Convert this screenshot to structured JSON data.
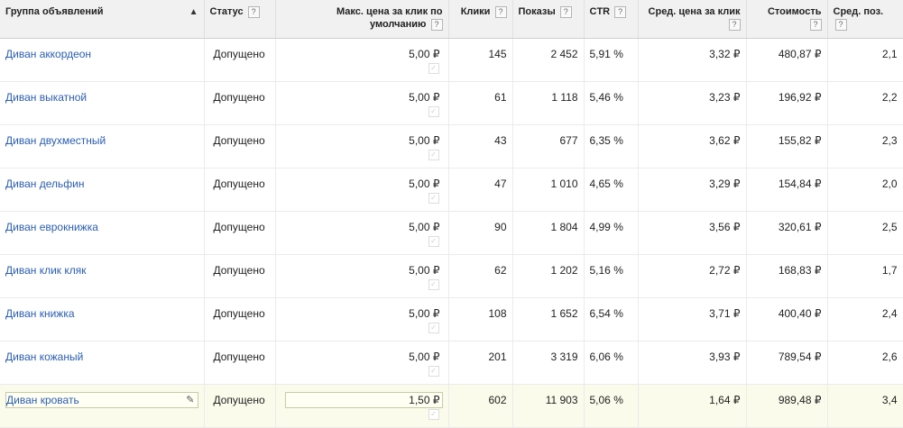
{
  "headers": {
    "group": "Группа объявлений",
    "status": "Статус",
    "max_cpc": "Макс. цена за клик по умолчанию",
    "clicks": "Клики",
    "impressions": "Показы",
    "ctr": "CTR",
    "avg_cpc": "Сред. цена за клик",
    "cost": "Стоимость",
    "avg_pos": "Сред. поз."
  },
  "help_glyph": "?",
  "sort_glyph": "▲",
  "edit_glyph": "✎",
  "check_glyph": "✓",
  "rows": [
    {
      "group": "Диван аккордеон",
      "status": "Допущено",
      "max_cpc": "5,00 ₽",
      "clicks": "145",
      "impressions": "2 452",
      "ctr": "5,91 %",
      "avg_cpc": "3,32 ₽",
      "cost": "480,87 ₽",
      "avg_pos": "2,1"
    },
    {
      "group": "Диван выкатной",
      "status": "Допущено",
      "max_cpc": "5,00 ₽",
      "clicks": "61",
      "impressions": "1 118",
      "ctr": "5,46 %",
      "avg_cpc": "3,23 ₽",
      "cost": "196,92 ₽",
      "avg_pos": "2,2"
    },
    {
      "group": "Диван двухместный",
      "status": "Допущено",
      "max_cpc": "5,00 ₽",
      "clicks": "43",
      "impressions": "677",
      "ctr": "6,35 %",
      "avg_cpc": "3,62 ₽",
      "cost": "155,82 ₽",
      "avg_pos": "2,3"
    },
    {
      "group": "Диван дельфин",
      "status": "Допущено",
      "max_cpc": "5,00 ₽",
      "clicks": "47",
      "impressions": "1 010",
      "ctr": "4,65 %",
      "avg_cpc": "3,29 ₽",
      "cost": "154,84 ₽",
      "avg_pos": "2,0"
    },
    {
      "group": "Диван еврокнижка",
      "status": "Допущено",
      "max_cpc": "5,00 ₽",
      "clicks": "90",
      "impressions": "1 804",
      "ctr": "4,99 %",
      "avg_cpc": "3,56 ₽",
      "cost": "320,61 ₽",
      "avg_pos": "2,5"
    },
    {
      "group": "Диван клик кляк",
      "status": "Допущено",
      "max_cpc": "5,00 ₽",
      "clicks": "62",
      "impressions": "1 202",
      "ctr": "5,16 %",
      "avg_cpc": "2,72 ₽",
      "cost": "168,83 ₽",
      "avg_pos": "1,7"
    },
    {
      "group": "Диван книжка",
      "status": "Допущено",
      "max_cpc": "5,00 ₽",
      "clicks": "108",
      "impressions": "1 652",
      "ctr": "6,54 %",
      "avg_cpc": "3,71 ₽",
      "cost": "400,40 ₽",
      "avg_pos": "2,4"
    },
    {
      "group": "Диван кожаный",
      "status": "Допущено",
      "max_cpc": "5,00 ₽",
      "clicks": "201",
      "impressions": "3 319",
      "ctr": "6,06 %",
      "avg_cpc": "3,93 ₽",
      "cost": "789,54 ₽",
      "avg_pos": "2,6"
    },
    {
      "group": "Диван кровать",
      "status": "Допущено",
      "max_cpc": "1,50 ₽",
      "clicks": "602",
      "impressions": "11 903",
      "ctr": "5,06 %",
      "avg_cpc": "1,64 ₽",
      "cost": "989,48 ₽",
      "avg_pos": "3,4"
    }
  ]
}
